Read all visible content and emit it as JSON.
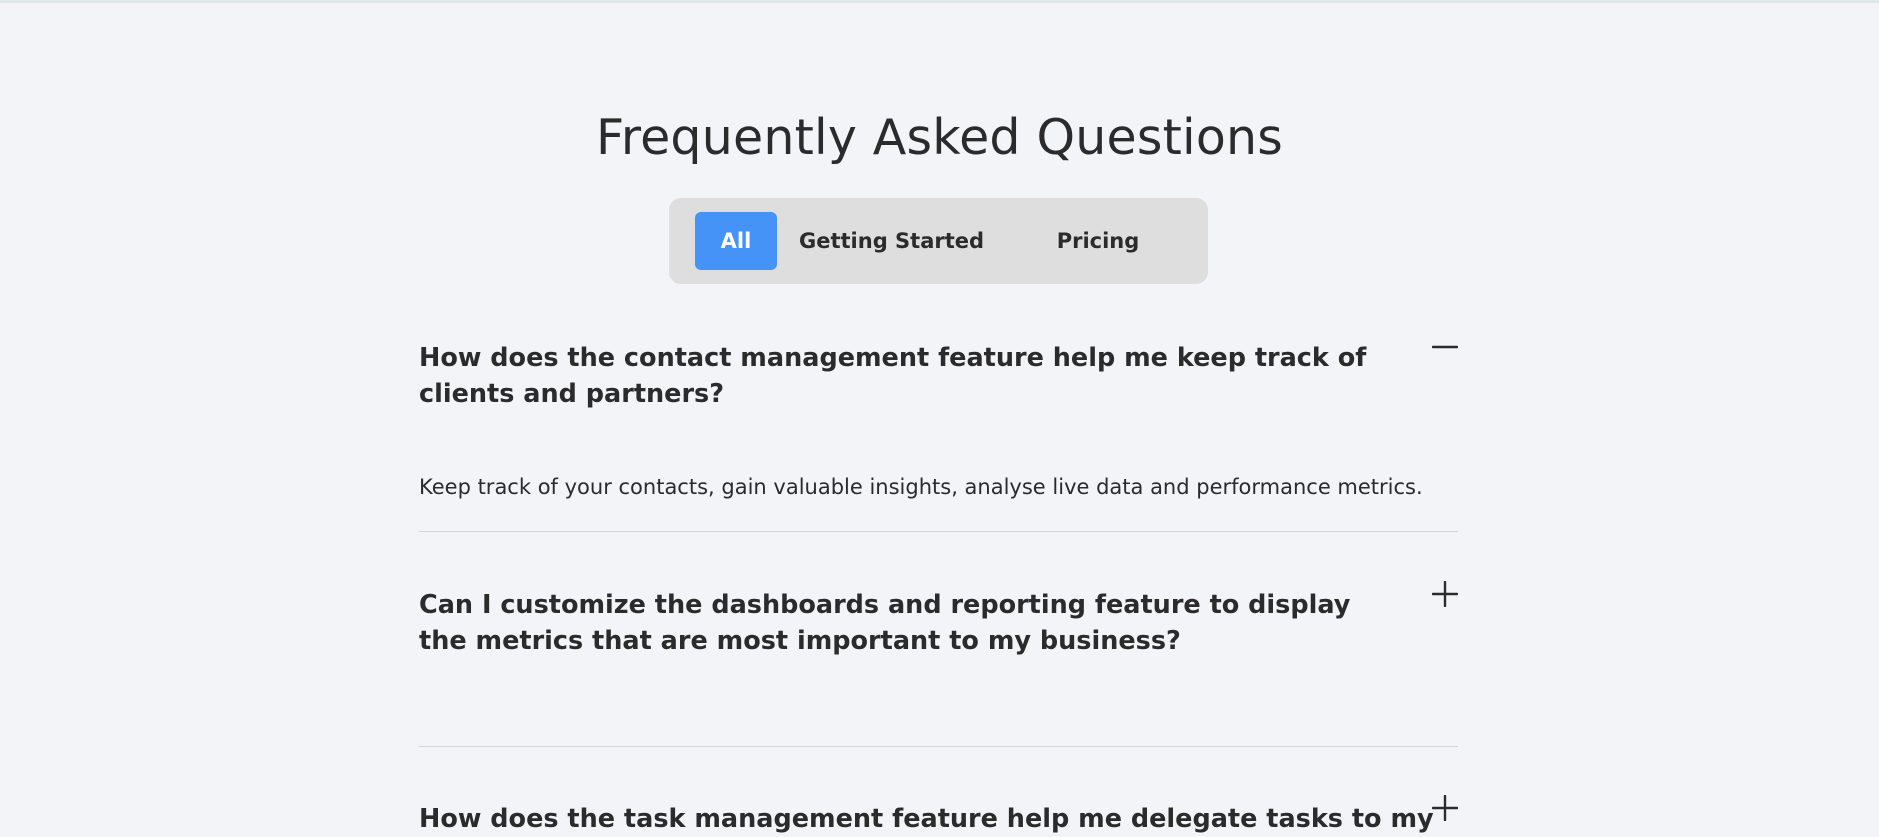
{
  "faq": {
    "title": "Frequently Asked Questions",
    "tabs": [
      {
        "label": "All",
        "active": true
      },
      {
        "label": "Getting Started",
        "active": false
      },
      {
        "label": "Pricing",
        "active": false
      }
    ],
    "items": [
      {
        "question": "How does the contact management feature help me keep track of clients and partners?",
        "answer": "Keep track of your contacts, gain valuable insights, analyse live data and performance metrics.",
        "expanded": true,
        "toggle_icon": "minus-icon"
      },
      {
        "question": "Can I customize the dashboards and reporting feature to display the metrics that are most important to my business?",
        "expanded": false,
        "toggle_icon": "plus-icon"
      },
      {
        "question": "How does the task management feature help me delegate tasks to my",
        "expanded": false,
        "toggle_icon": "plus-icon"
      }
    ]
  },
  "colors": {
    "background": "#f3f4f7",
    "accent": "#4593f7",
    "tab_bar": "#dedede",
    "text": "#2b2b2b",
    "divider": "#d2d3d6"
  }
}
